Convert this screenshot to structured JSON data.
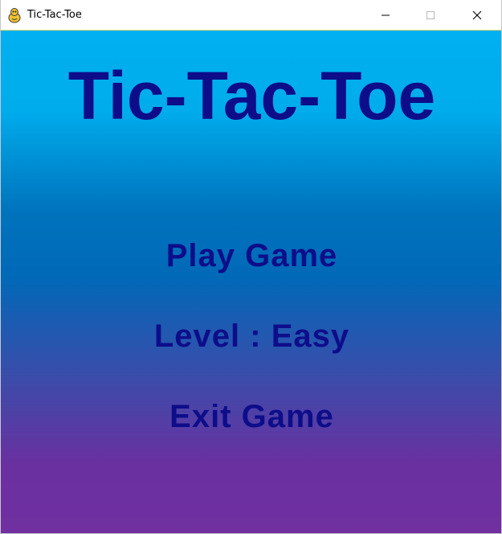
{
  "window": {
    "title": "Tic-Tac-Toe",
    "app_icon": "pygame-snake-icon"
  },
  "game": {
    "title": "Tic-Tac-Toe",
    "menu": {
      "play_label": "Play Game",
      "level_label": "Level : Easy",
      "exit_label": "Exit Game"
    }
  },
  "colors": {
    "text": "#0d0d8a",
    "gradient_top": "#00b0f0",
    "gradient_mid": "#0069b8",
    "gradient_bottom": "#7030a0"
  }
}
